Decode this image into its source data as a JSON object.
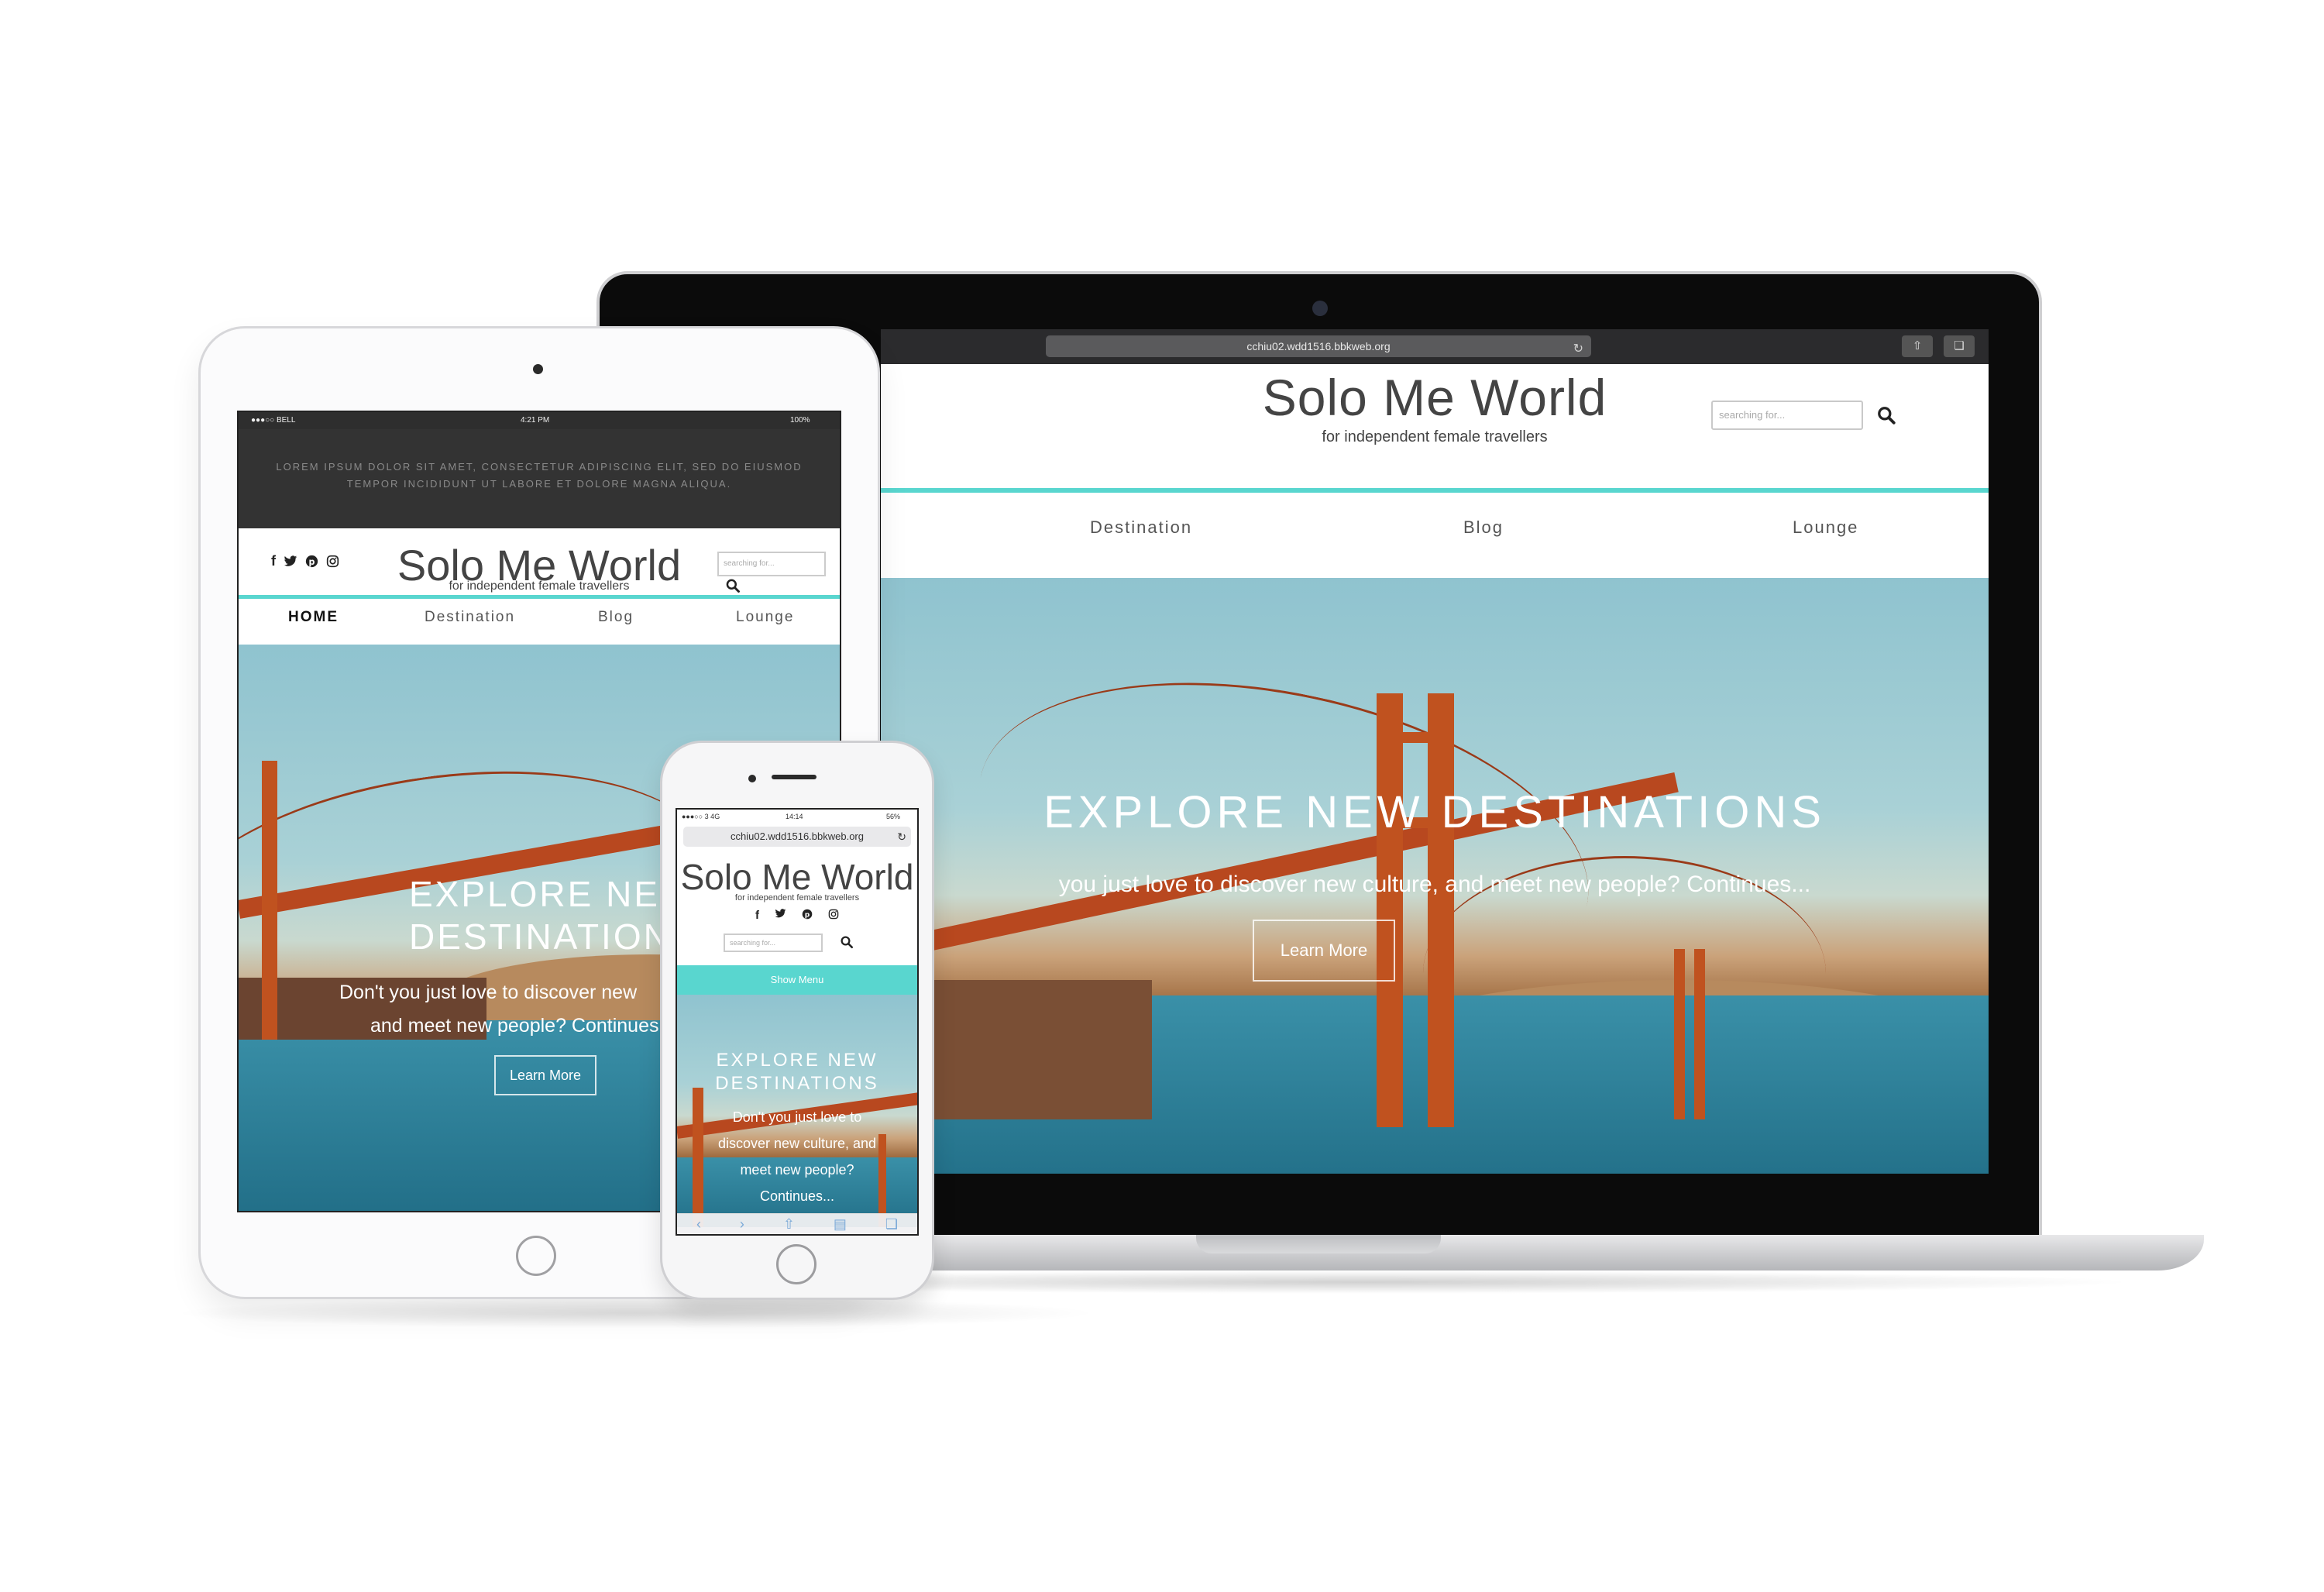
{
  "site": {
    "logo": "Solo Me World",
    "tagline": "for independent female travellers",
    "search_placeholder": "searching for...",
    "url": "cchiu02.wdd1516.bbkweb.org"
  },
  "laptop": {
    "nav": [
      "Destination",
      "Blog",
      "Lounge"
    ],
    "hero": {
      "title": "EXPLORE NEW DESTINATIONS",
      "text": "you just love to discover new culture, and meet new people? Continues...",
      "button": "Learn More"
    }
  },
  "tablet": {
    "status": {
      "carrier": "●●●○○ BELL",
      "time": "4:21 PM",
      "battery": "100%"
    },
    "banner": "LOREM IPSUM DOLOR SIT AMET, CONSECTETUR ADIPISCING ELIT, SED DO EIUSMOD TEMPOR INCIDIDUNT UT LABORE ET DOLORE MAGNA ALIQUA.",
    "nav": [
      "HOME",
      "Destination",
      "Blog",
      "Lounge"
    ],
    "hero": {
      "title_line1": "EXPLORE NEW",
      "title_line2": "DESTINATIONS",
      "text_line1": "Don't you just love to discover new",
      "text_line2": "and meet new people? Continues...",
      "button": "Learn More"
    }
  },
  "phone": {
    "status": {
      "carrier": "●●●○○ 3  4G",
      "time": "14:14",
      "battery": "56%"
    },
    "menu_button": "Show Menu",
    "hero": {
      "title_line1": "EXPLORE NEW",
      "title_line2": "DESTINATIONS",
      "text": "Don't you just love to discover new culture, and meet new people? Continues..."
    }
  },
  "icons": [
    "facebook-icon",
    "twitter-icon",
    "pinterest-icon",
    "instagram-icon",
    "search-icon",
    "reload-icon",
    "share-icon",
    "tabs-icon"
  ],
  "colors": {
    "accent": "#59d6cf",
    "text": "#444444",
    "toolbar": "#2b2b2d"
  }
}
